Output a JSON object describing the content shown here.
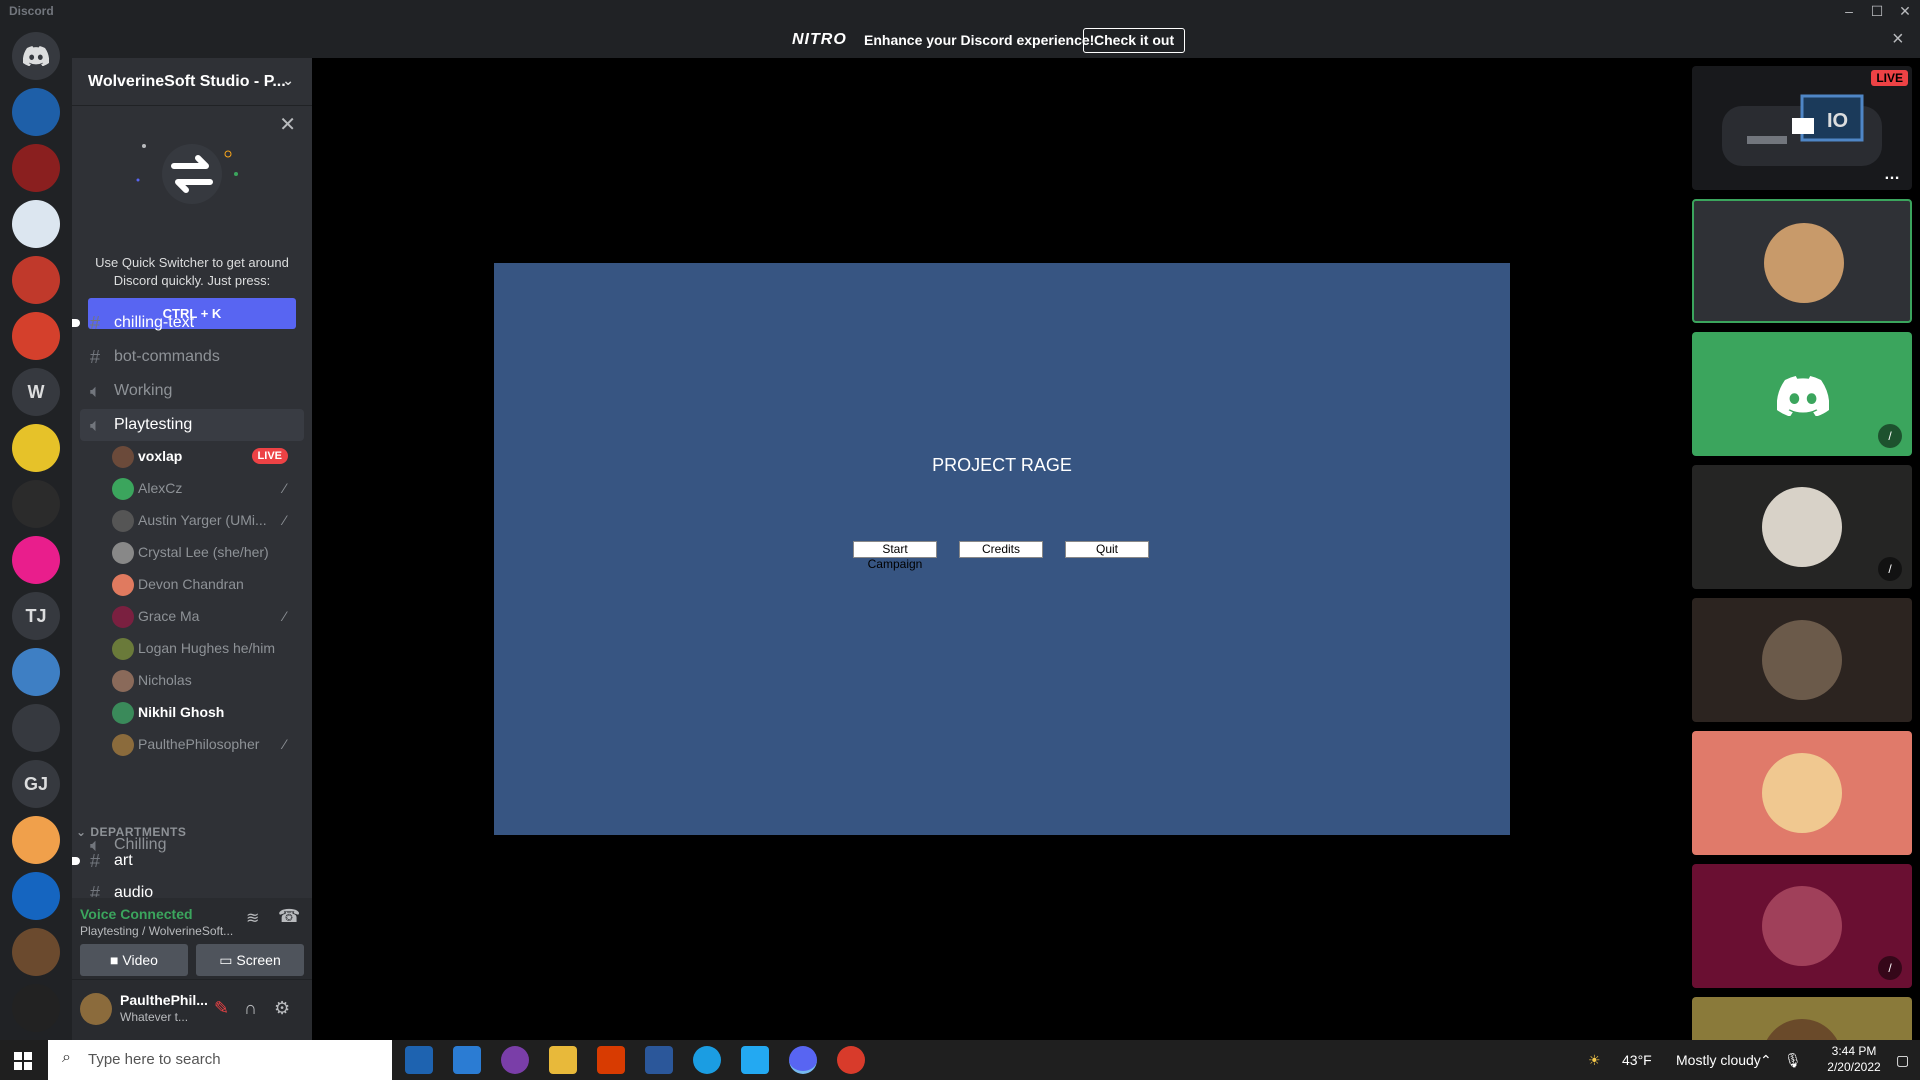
{
  "window": {
    "title": "Discord"
  },
  "nitro": {
    "logo": "NITRO",
    "message": "Enhance your Discord experience!",
    "cta": "Check it out"
  },
  "server": {
    "name": "WolverineSoft Studio - P..."
  },
  "quick_switcher": {
    "text": "Use Quick Switcher to get around Discord quickly. Just press:",
    "shortcut": "CTRL + K"
  },
  "servers": [
    {
      "label": "",
      "color": "#1e5fa8"
    },
    {
      "label": "",
      "color": "#8a1f1f"
    },
    {
      "label": "",
      "color": "#dce6f0"
    },
    {
      "label": "",
      "color": "#c0392b"
    },
    {
      "label": "",
      "color": "#d4402c"
    },
    {
      "label": "W",
      "color": "#36393f"
    },
    {
      "label": "",
      "color": "#e6c229"
    },
    {
      "label": "",
      "color": "#2b2b2b"
    },
    {
      "label": "",
      "color": "#e91e8c"
    },
    {
      "label": "TJ",
      "color": "#36393f"
    },
    {
      "label": "",
      "color": "#3e7fc4"
    },
    {
      "label": "",
      "color": "#36393f"
    },
    {
      "label": "GJ",
      "color": "#36393f"
    },
    {
      "label": "",
      "color": "#f0a04b"
    },
    {
      "label": "",
      "color": "#1565c0"
    },
    {
      "label": "",
      "color": "#6b4a2e"
    },
    {
      "label": "",
      "color": "#222"
    }
  ],
  "channels": {
    "chilling_text": "chilling-text",
    "bot_commands": "bot-commands",
    "working": "Working",
    "playtesting": "Playtesting",
    "chilling": "Chilling",
    "category_departments": "DEPARTMENTS",
    "art": "art",
    "audio": "audio"
  },
  "voice_users": [
    {
      "name": "voxlap",
      "live": "LIVE",
      "muted": false,
      "color": "#6b4a3a",
      "bright": true
    },
    {
      "name": "AlexCz",
      "muted": true,
      "color": "#3ba55d"
    },
    {
      "name": "Austin Yarger (UMi...",
      "muted": true,
      "color": "#555"
    },
    {
      "name": "Crystal Lee (she/her)",
      "muted": false,
      "color": "#888"
    },
    {
      "name": "Devon Chandran",
      "muted": false,
      "color": "#e07a5f"
    },
    {
      "name": "Grace Ma",
      "muted": true,
      "color": "#7a2040"
    },
    {
      "name": "Logan Hughes he/him",
      "muted": false,
      "color": "#6a7a3a"
    },
    {
      "name": "Nicholas",
      "muted": false,
      "color": "#8a6a5a"
    },
    {
      "name": "Nikhil Ghosh",
      "muted": false,
      "color": "#3a8a5a",
      "bright": true
    },
    {
      "name": "PaulthePhilosopher",
      "muted": true,
      "color": "#8b6b3c"
    }
  ],
  "voice_panel": {
    "status": "Voice Connected",
    "location": "Playtesting / WolverineSoft...",
    "video": "Video",
    "screen": "Screen"
  },
  "user_panel": {
    "name": "PaulthePhil...",
    "status": "Whatever t..."
  },
  "game": {
    "title": "PROJECT RAGE",
    "buttons": [
      "Start Campaign",
      "Credits",
      "Quit"
    ]
  },
  "tiles": {
    "live": "LIVE",
    "stream_text": "IO"
  },
  "taskbar": {
    "search_placeholder": "Type here to search",
    "temperature": "43°F",
    "weather": "Mostly cloudy",
    "time": "3:44 PM",
    "date": "2/20/2022"
  }
}
